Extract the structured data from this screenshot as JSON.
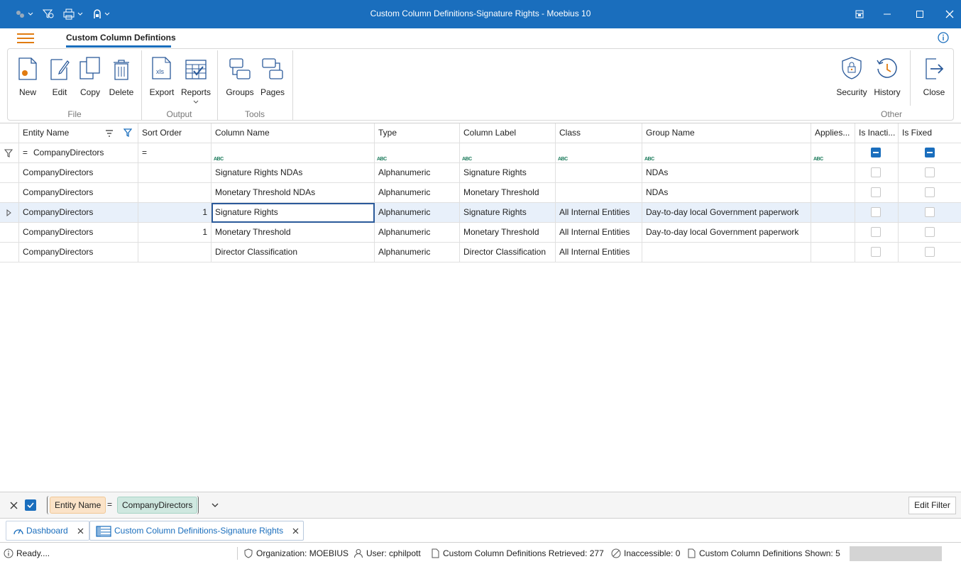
{
  "window": {
    "title": "Custom Column Definitions-Signature Rights - Moebius 10"
  },
  "menu": {
    "active_tab": "Custom Column Defintions"
  },
  "ribbon": {
    "file": {
      "label": "File",
      "new": "New",
      "edit": "Edit",
      "copy": "Copy",
      "delete": "Delete"
    },
    "output": {
      "label": "Output",
      "export": "Export",
      "reports": "Reports",
      "xls": "xls"
    },
    "tools": {
      "label": "Tools",
      "groups": "Groups",
      "pages": "Pages"
    },
    "other": {
      "label": "Other",
      "security": "Security",
      "history": "History",
      "close": "Close"
    }
  },
  "grid": {
    "headers": [
      "Entity Name",
      "Sort Order",
      "Column Name",
      "Type",
      "Column Label",
      "Class",
      "Group Name",
      "Applies...",
      "Is Inacti...",
      "Is Fixed"
    ],
    "filter_row": {
      "entity": "CompanyDirectors",
      "eq": "=",
      "abc": "ABC"
    },
    "rows": [
      {
        "entity": "CompanyDirectors",
        "sort": "",
        "column": "Signature Rights NDAs",
        "type": "Alphanumeric",
        "label": "Signature Rights",
        "class": "",
        "group": "NDAs",
        "applies": "",
        "inactive": false,
        "fixed": false
      },
      {
        "entity": "CompanyDirectors",
        "sort": "",
        "column": "Monetary Threshold NDAs",
        "type": "Alphanumeric",
        "label": "Monetary Threshold",
        "class": "",
        "group": "NDAs",
        "applies": "",
        "inactive": false,
        "fixed": false
      },
      {
        "entity": "CompanyDirectors",
        "sort": "1",
        "column": "Signature Rights",
        "type": "Alphanumeric",
        "label": "Signature Rights",
        "class": "All Internal Entities",
        "group": "Day-to-day local Government paperwork",
        "applies": "",
        "inactive": false,
        "fixed": false
      },
      {
        "entity": "CompanyDirectors",
        "sort": "1",
        "column": "Monetary Threshold",
        "type": "Alphanumeric",
        "label": "Monetary Threshold",
        "class": "All Internal Entities",
        "group": "Day-to-day local Government paperwork",
        "applies": "",
        "inactive": false,
        "fixed": false
      },
      {
        "entity": "CompanyDirectors",
        "sort": "",
        "column": "Director Classification",
        "type": "Alphanumeric",
        "label": "Director Classification",
        "class": "All Internal Entities",
        "group": "",
        "applies": "",
        "inactive": false,
        "fixed": false
      }
    ]
  },
  "filter": {
    "field": "Entity Name",
    "op": "=",
    "value": "CompanyDirectors",
    "edit": "Edit Filter"
  },
  "tabs": {
    "dashboard": "Dashboard",
    "current": "Custom Column Definitions-Signature Rights"
  },
  "status": {
    "ready": "Ready....",
    "org": "Organization: MOEBIUS",
    "user": "User: cphilpott",
    "retrieved": "Custom Column Definitions Retrieved: 277",
    "inaccessible": "Inaccessible: 0",
    "shown": "Custom Column Definitions Shown: 5"
  },
  "colors": {
    "accent": "#1a6ebd",
    "orange": "#e07b10"
  }
}
